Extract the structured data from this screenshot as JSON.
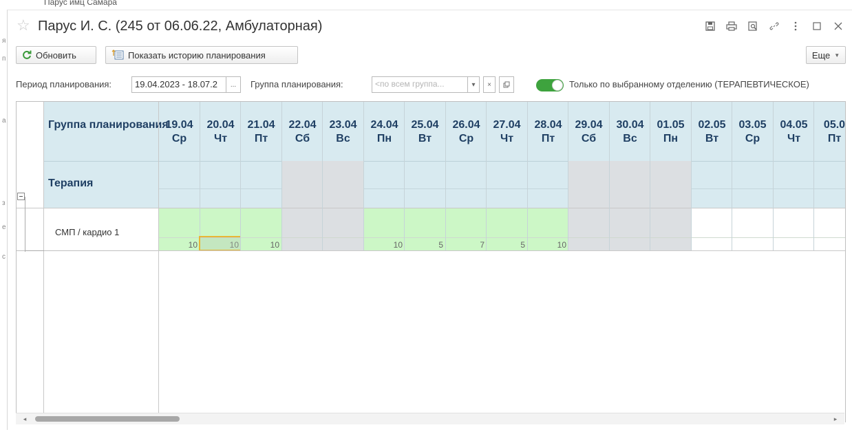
{
  "background": {
    "title": "Парус имц Самара",
    "side_letters": [
      "я",
      "п",
      "а",
      "з",
      "е",
      "с"
    ]
  },
  "window": {
    "title": "Парус И. С. (245 от 06.06.22, Амбулаторная)",
    "icons": [
      "save-icon",
      "print-icon",
      "preview-icon",
      "link-icon",
      "more-vertical-icon",
      "maximize-icon",
      "close-icon"
    ]
  },
  "toolbar": {
    "refresh_label": "Обновить",
    "history_label": "Показать историю планирования",
    "more_label": "Еще"
  },
  "filters": {
    "period_label": "Период планирования:",
    "period_value": "19.04.2023 - 18.07.2",
    "group_label": "Группа планирования:",
    "group_placeholder": "<по всем группа...",
    "toggle_on": true,
    "toggle_label": "Только по выбранному отделению (ТЕРАПЕВТИЧЕСКОЕ)"
  },
  "grid": {
    "group_header": "Группа планирования",
    "days": [
      {
        "date": "19.04",
        "dow": "Ср",
        "value": "10",
        "state": "green"
      },
      {
        "date": "20.04",
        "dow": "Чт",
        "value": "10",
        "state": "green-selected"
      },
      {
        "date": "21.04",
        "dow": "Пт",
        "value": "10",
        "state": "green"
      },
      {
        "date": "22.04",
        "dow": "Сб",
        "value": "",
        "state": "gray"
      },
      {
        "date": "23.04",
        "dow": "Вс",
        "value": "",
        "state": "gray"
      },
      {
        "date": "24.04",
        "dow": "Пн",
        "value": "10",
        "state": "green"
      },
      {
        "date": "25.04",
        "dow": "Вт",
        "value": "5",
        "state": "green"
      },
      {
        "date": "26.04",
        "dow": "Ср",
        "value": "7",
        "state": "green"
      },
      {
        "date": "27.04",
        "dow": "Чт",
        "value": "5",
        "state": "green"
      },
      {
        "date": "28.04",
        "dow": "Пт",
        "value": "10",
        "state": "green"
      },
      {
        "date": "29.04",
        "dow": "Сб",
        "value": "",
        "state": "gray"
      },
      {
        "date": "30.04",
        "dow": "Вс",
        "value": "",
        "state": "gray"
      },
      {
        "date": "01.05",
        "dow": "Пн",
        "value": "",
        "state": "gray"
      },
      {
        "date": "02.05",
        "dow": "Вт",
        "value": "",
        "state": "white"
      },
      {
        "date": "03.05",
        "dow": "Ср",
        "value": "",
        "state": "white"
      },
      {
        "date": "04.05",
        "dow": "Чт",
        "value": "",
        "state": "white"
      },
      {
        "date": "05.0",
        "dow": "Пт",
        "value": "",
        "state": "white"
      }
    ],
    "group_row_label": "Терапия",
    "item_row_label": "СМП / кардио 1"
  },
  "colors": {
    "header_bg": "#d8eaf0",
    "green": "#ccf7c6",
    "gray": "#dcdfe2",
    "selected_border": "#e8b634",
    "toggle": "#3ea33e",
    "heading_text": "#1f3f63"
  }
}
